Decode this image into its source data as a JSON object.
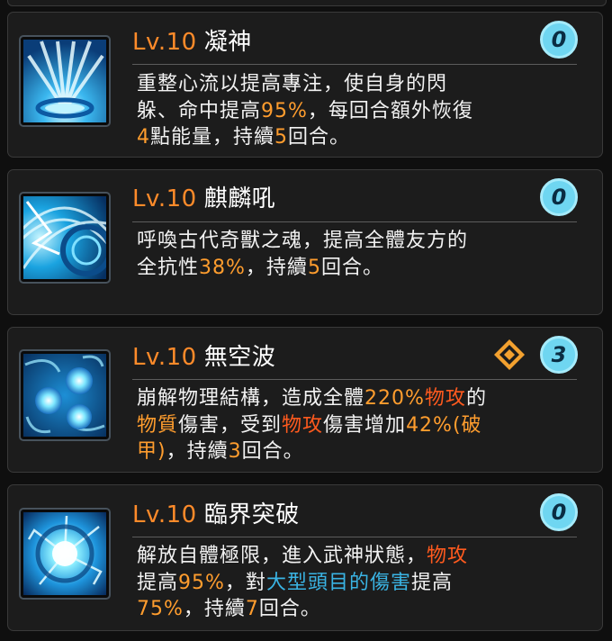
{
  "skills": [
    {
      "level": "Lv.10",
      "name": "凝神",
      "icon": "focus-light-rays-icon",
      "cost": "0",
      "desc_lines": [
        [
          {
            "t": "重整心流以提高專注，使自身的閃",
            "c": ""
          }
        ],
        [
          {
            "t": "躲、命中提高",
            "c": ""
          },
          {
            "t": "95%",
            "c": "orange"
          },
          {
            "t": "，每回合額外恢復",
            "c": ""
          }
        ],
        [
          {
            "t": "4",
            "c": "orange"
          },
          {
            "t": "點能量，持續",
            "c": ""
          },
          {
            "t": "5",
            "c": "orange"
          },
          {
            "t": "回合。",
            "c": ""
          }
        ]
      ]
    },
    {
      "level": "Lv.10",
      "name": "麒麟吼",
      "icon": "beast-roar-vortex-icon",
      "cost": "0",
      "desc_lines": [
        [
          {
            "t": "呼喚古代奇獸之魂，提高全體友方的",
            "c": ""
          }
        ],
        [
          {
            "t": "全抗性",
            "c": ""
          },
          {
            "t": "38%",
            "c": "orange"
          },
          {
            "t": "，持續",
            "c": ""
          },
          {
            "t": "5",
            "c": "orange"
          },
          {
            "t": "回合。",
            "c": ""
          }
        ]
      ]
    },
    {
      "level": "Lv.10",
      "name": "無空波",
      "icon": "triple-wave-orbs-icon",
      "cost": "3",
      "break_icon": "armor-break-diamond-icon",
      "desc_lines": [
        [
          {
            "t": "崩解物理結構，造成全體",
            "c": ""
          },
          {
            "t": "220%",
            "c": "orange"
          },
          {
            "t": "物攻",
            "c": "red"
          },
          {
            "t": "的",
            "c": ""
          }
        ],
        [
          {
            "t": "物質",
            "c": "orange"
          },
          {
            "t": "傷害，受到",
            "c": ""
          },
          {
            "t": "物攻",
            "c": "red"
          },
          {
            "t": "傷害增加",
            "c": ""
          },
          {
            "t": "42%",
            "c": "orange"
          },
          {
            "t": "(破",
            "c": "orange"
          }
        ],
        [
          {
            "t": "甲)",
            "c": "orange"
          },
          {
            "t": "，持續",
            "c": ""
          },
          {
            "t": "3",
            "c": "orange"
          },
          {
            "t": "回合。",
            "c": ""
          }
        ]
      ]
    },
    {
      "level": "Lv.10",
      "name": "臨界突破",
      "icon": "energy-burst-orb-icon",
      "cost": "0",
      "desc_lines": [
        [
          {
            "t": "解放自體極限，進入武神狀態，",
            "c": ""
          },
          {
            "t": "物攻",
            "c": "red"
          }
        ],
        [
          {
            "t": "提高",
            "c": ""
          },
          {
            "t": "95%",
            "c": "orange"
          },
          {
            "t": "，對",
            "c": ""
          },
          {
            "t": "大型頭目的傷害",
            "c": "blue"
          },
          {
            "t": "提高",
            "c": ""
          }
        ],
        [
          {
            "t": "75%",
            "c": "orange"
          },
          {
            "t": "，持續",
            "c": ""
          },
          {
            "t": "7",
            "c": "orange"
          },
          {
            "t": "回合。",
            "c": ""
          }
        ]
      ]
    }
  ]
}
